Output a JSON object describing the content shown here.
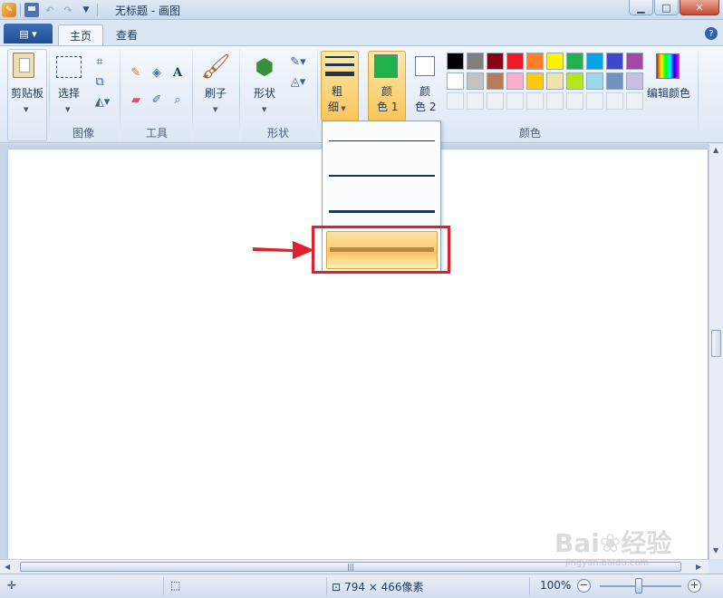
{
  "window": {
    "title": "无标题 - 画图"
  },
  "tabs": [
    {
      "label": "主页",
      "active": true
    },
    {
      "label": "查看",
      "active": false
    }
  ],
  "ribbon": {
    "clipboard": {
      "label": "剪贴板"
    },
    "image": {
      "select_label": "选择",
      "group_label": "图像"
    },
    "tools": {
      "group_label": "工具"
    },
    "brushes": {
      "label": "刷子"
    },
    "shapes": {
      "label": "形状",
      "group_label": "形状"
    },
    "size": {
      "label_line1": "粗",
      "label_line2": "细"
    },
    "color1": {
      "label_line1": "颜",
      "label_line2": "色 1",
      "value": "#1fb14b"
    },
    "color2": {
      "label_line1": "颜",
      "label_line2": "色 2",
      "value": "#ffffff"
    },
    "edit_colors": {
      "label": "编辑颜色"
    },
    "colors_group_label": "颜色",
    "palette_row1": [
      "#000000",
      "#7f7f7f",
      "#880015",
      "#ed1c24",
      "#ff7f27",
      "#fff200",
      "#22b14c",
      "#00a2e8",
      "#3f48cc",
      "#a349a4"
    ],
    "palette_row2": [
      "#ffffff",
      "#c3c3c3",
      "#b97a57",
      "#ffaec9",
      "#ffc90e",
      "#efe4b0",
      "#b5e61d",
      "#99d9ea",
      "#7092be",
      "#c8bfe7"
    ]
  },
  "size_dropdown": {
    "options": [
      {
        "thickness_px": 1
      },
      {
        "thickness_px": 2
      },
      {
        "thickness_px": 3
      },
      {
        "thickness_px": 5,
        "highlighted": true
      }
    ]
  },
  "statusbar": {
    "canvas_size": "794 × 466像素",
    "zoom": "100%"
  },
  "watermark": {
    "text": "Bai du经验",
    "sub": "jingyan.baidu.com"
  }
}
